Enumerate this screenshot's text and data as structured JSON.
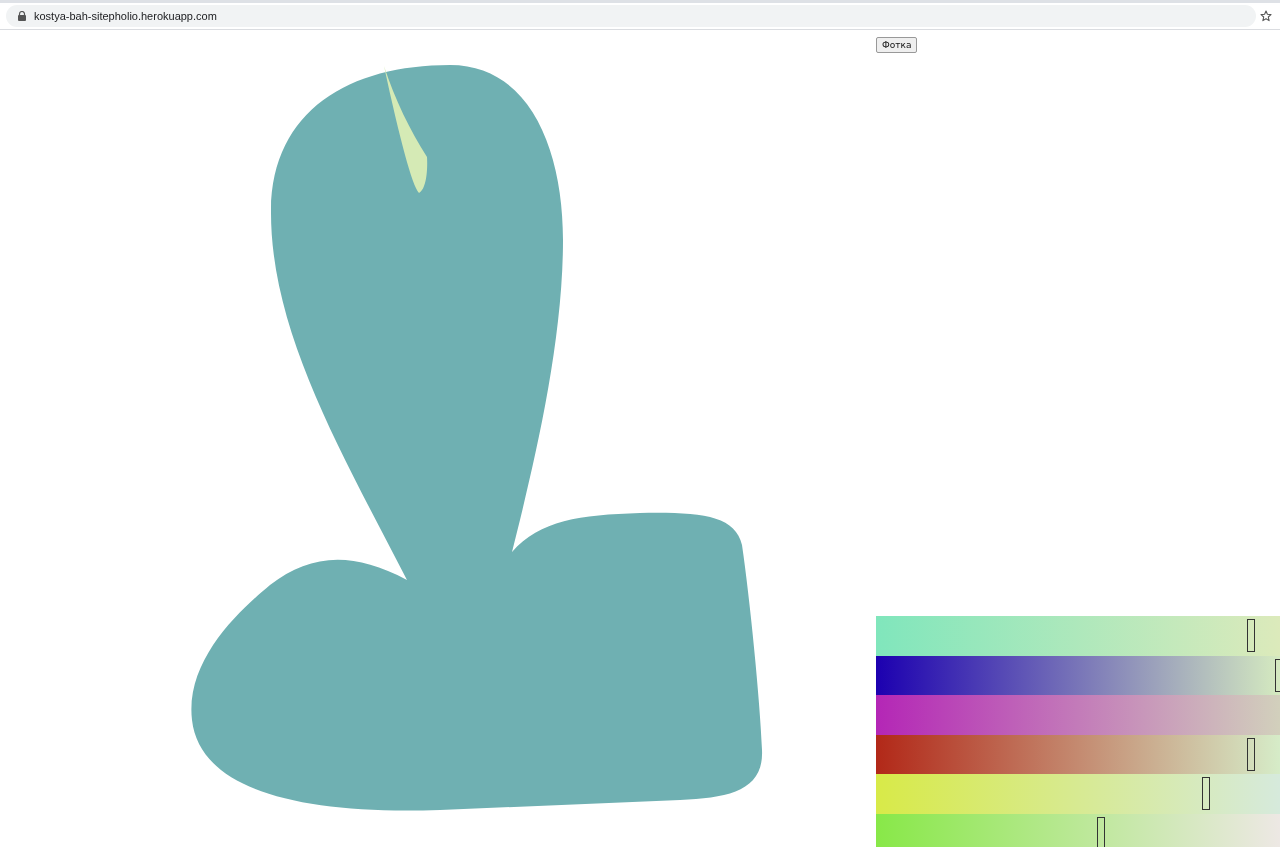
{
  "browser": {
    "url": "kostya-bah-sitepholio.herokuapp.com"
  },
  "button": {
    "label": "Фотка"
  },
  "sliders": [
    {
      "stops": [
        {
          "color": "#80e6bc"
        },
        {
          "color": "#dceabb"
        }
      ],
      "level": 0.93
    },
    {
      "stops": [
        {
          "color": "#1c00b0"
        },
        {
          "color": "#d5eac0"
        }
      ],
      "level": 1.0
    },
    {
      "stops": [
        {
          "color": "#b426b6"
        },
        {
          "color": "#d2d0bc"
        }
      ]
    },
    {
      "stops": [
        {
          "color": "#b22818"
        },
        {
          "color": "#d6ecc8"
        }
      ],
      "level": 0.93
    },
    {
      "stops": [
        {
          "color": "#d8ea48"
        },
        {
          "color": "#d6eadc"
        }
      ],
      "level": 0.82
    },
    {
      "stops": [
        {
          "color": "#88e848"
        },
        {
          "color": "#ede8e4"
        }
      ],
      "level": 0.56
    }
  ]
}
